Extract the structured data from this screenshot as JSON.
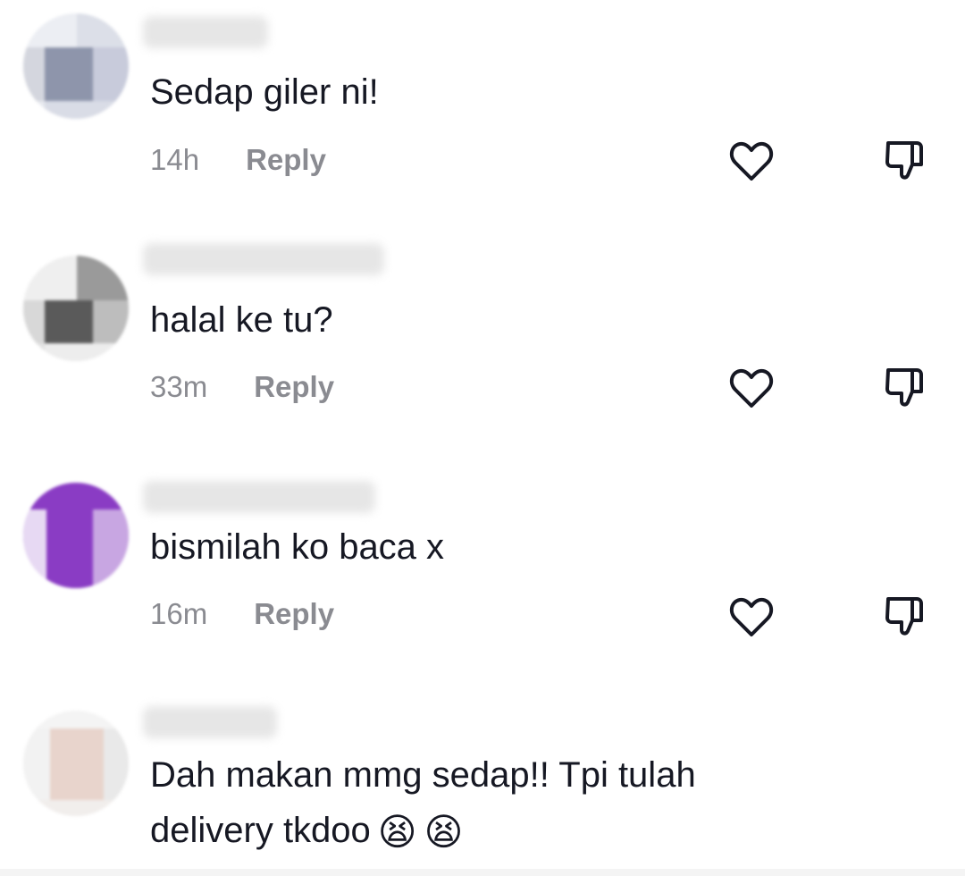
{
  "comments": [
    {
      "text": "Sedap giler ni!",
      "time": "14h",
      "reply": "Reply"
    },
    {
      "text": "halal ke tu?",
      "time": "33m",
      "reply": "Reply"
    },
    {
      "text": "bismilah ko baca x",
      "time": "16m",
      "reply": "Reply"
    },
    {
      "text": "Dah makan mmg sedap!! Tpi tulah\ndelivery tkdoo",
      "emojis": [
        "😫",
        "😫"
      ]
    }
  ],
  "icons": {
    "like": "heart-outline-icon",
    "dislike": "thumbs-down-outline-icon"
  },
  "colors": {
    "text": "#161823",
    "secondary": "#8a8b91",
    "purple_avatar": "#8a3cc4"
  }
}
